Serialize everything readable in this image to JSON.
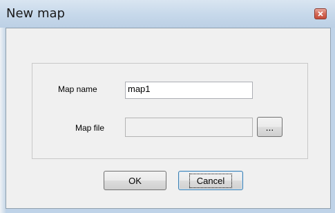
{
  "window": {
    "title": "New map",
    "close_icon": "close-icon"
  },
  "form": {
    "map_name_label": "Map name",
    "map_name_value": "map1",
    "map_file_label": "Map file",
    "map_file_value": "",
    "browse_label": "..."
  },
  "buttons": {
    "ok_label": "OK",
    "cancel_label": "Cancel"
  }
}
